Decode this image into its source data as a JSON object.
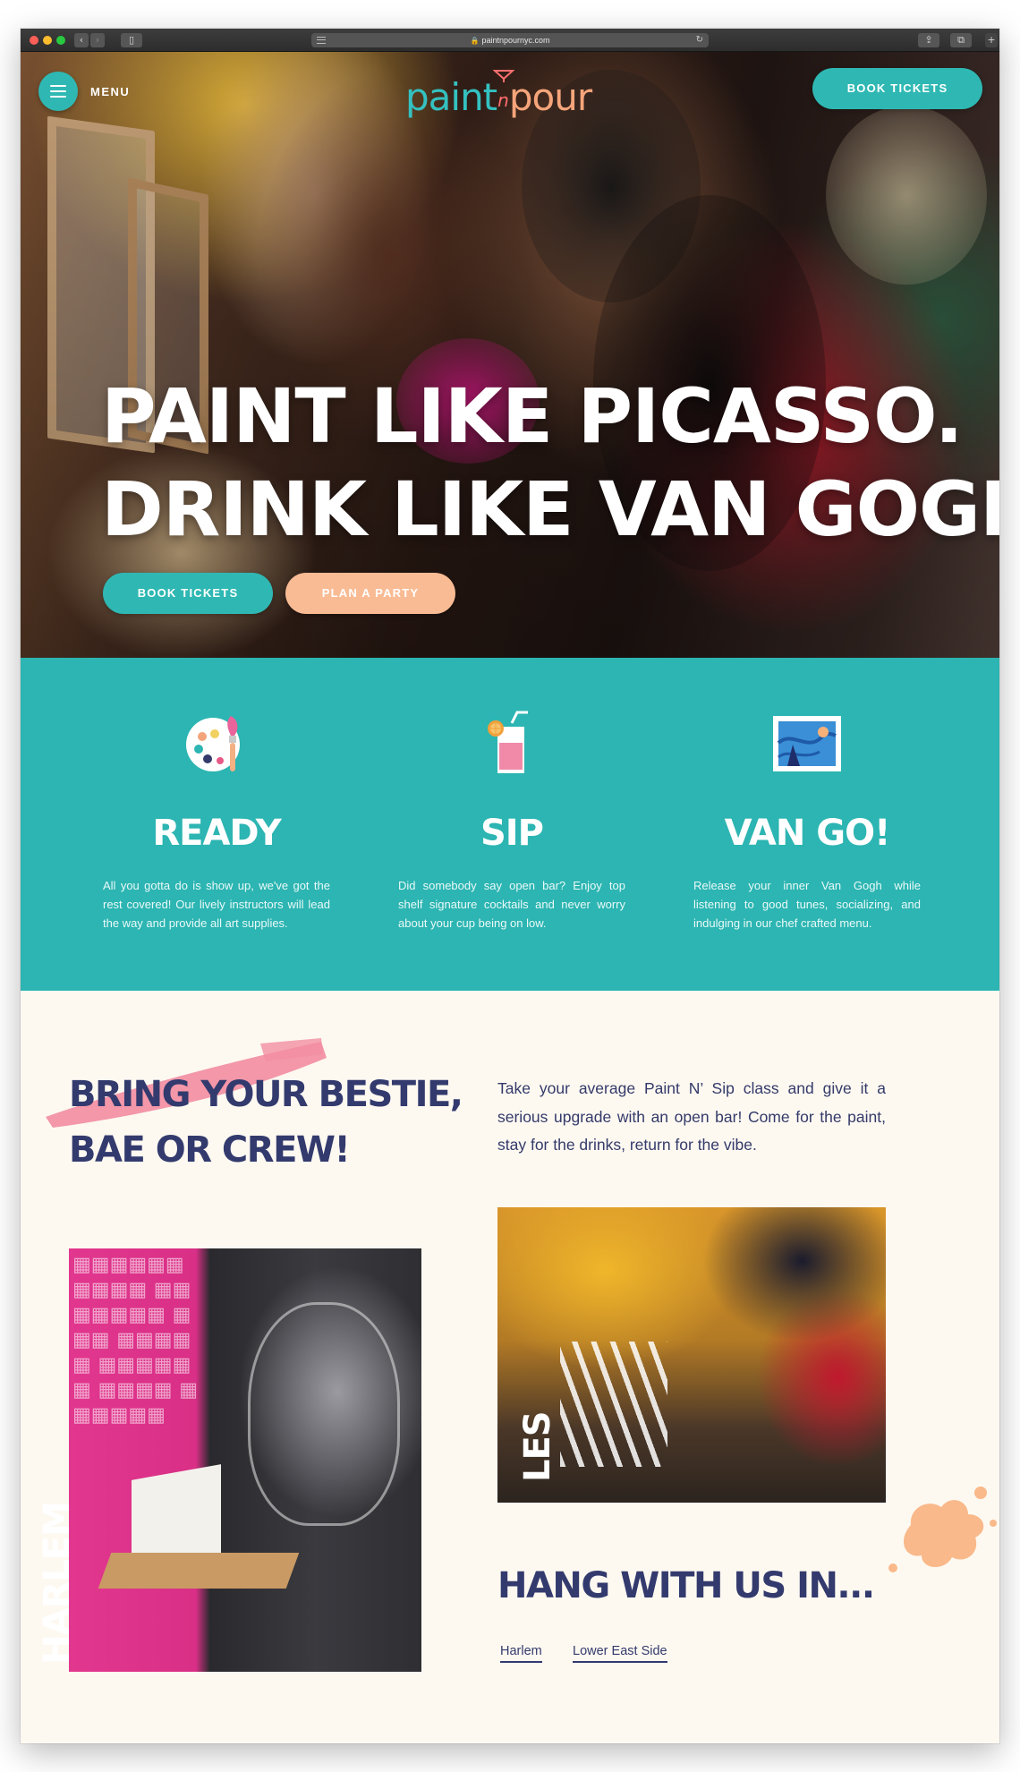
{
  "browser": {
    "url": "paintnpournyc.com",
    "lock_icon": "lock-icon",
    "reload_icon": "reload-icon"
  },
  "header": {
    "menu_label": "MENU",
    "logo": {
      "part1": "paint",
      "amp": "n",
      "part2": "pour"
    },
    "book_button": "BOOK TICKETS"
  },
  "hero": {
    "headline_line1": "PAINT LIKE PICASSO.",
    "headline_line2": "DRINK LIKE VAN GOGH.",
    "primary_button": "BOOK TICKETS",
    "secondary_button": "PLAN A PARTY"
  },
  "features": [
    {
      "icon": "palette-icon",
      "title": "READY",
      "text": "All you gotta do is show up, we've got the rest covered! Our lively instructors will lead the way and provide all art supplies."
    },
    {
      "icon": "cocktail-icon",
      "title": "SIP",
      "text": "Did somebody say open bar? Enjoy top shelf signature cocktails and never worry about your cup being on low."
    },
    {
      "icon": "painting-icon",
      "title": "VAN GO!",
      "text": "Release your inner Van Gogh while listening to good tunes, socializing, and indulging in our  chef crafted menu."
    }
  ],
  "crew": {
    "heading_line1": "BRING YOUR BESTIE,",
    "heading_line2": "BAE OR CREW!",
    "intro": "Take your average Paint N’ Sip class and give it a serious upgrade with an open bar! Come for the paint, stay for the drinks, return for the vibe."
  },
  "locations": {
    "harlem_label": "HARLEM",
    "les_label": "LES",
    "hang_heading": "HANG WITH US IN...",
    "links": [
      "Harlem",
      "Lower East Side"
    ]
  },
  "colors": {
    "teal": "#2fb8b3",
    "peach": "#f9bb94",
    "navy": "#333a6d",
    "cream": "#fdf9f1"
  }
}
